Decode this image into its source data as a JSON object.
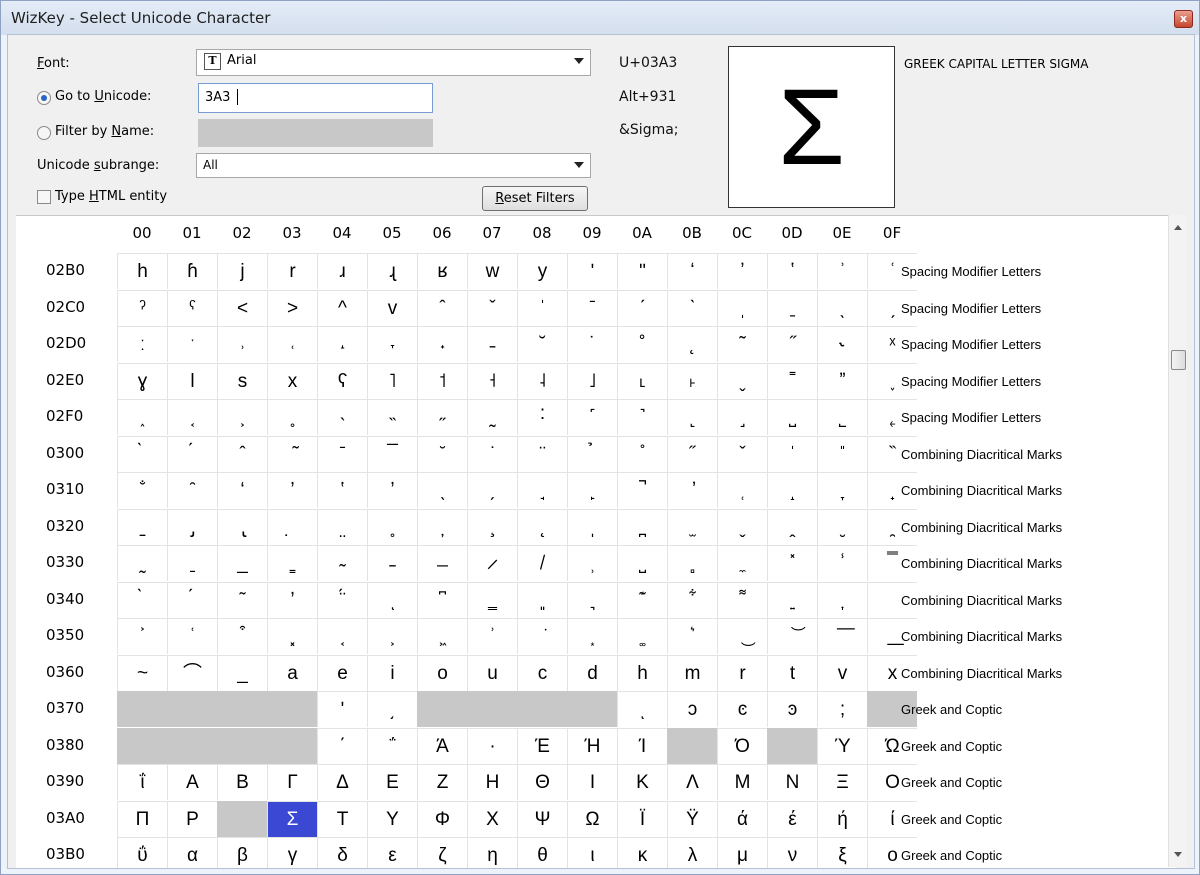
{
  "window": {
    "title": "WizKey - Select Unicode Character",
    "close_glyph": "x"
  },
  "controls": {
    "font_label_u": "F",
    "font_label_rest": "ont:",
    "font_value": "Arial",
    "font_icon_glyph": "T",
    "goto_label_pre": "Go to ",
    "goto_label_u": "U",
    "goto_label_rest": "nicode:",
    "goto_value": "3A3",
    "filter_label_pre": "Filter by ",
    "filter_label_u": "N",
    "filter_label_rest": "ame:",
    "subrange_label_pre": "Unicode ",
    "subrange_label_u": "s",
    "subrange_label_rest": "ubrange:",
    "subrange_value": "All",
    "html_label_pre": "Type ",
    "html_label_u": "H",
    "html_label_rest": "TML entity",
    "reset_u": "R",
    "reset_rest": "eset Filters"
  },
  "info": {
    "codepoint": "U+03A3",
    "alt_code": "Alt+931",
    "html_entity": "&Sigma;",
    "preview_glyph": "Σ",
    "char_name": "GREEK CAPITAL LETTER SIGMA"
  },
  "grid": {
    "columns": [
      "00",
      "01",
      "02",
      "03",
      "04",
      "05",
      "06",
      "07",
      "08",
      "09",
      "0A",
      "0B",
      "0C",
      "0D",
      "0E",
      "0F"
    ],
    "rows": [
      {
        "code": "02B0",
        "range": "Spacing Modifier Letters",
        "cells": [
          "h",
          "ɦ",
          "j",
          "r",
          "ɹ",
          "ɻ",
          "ʁ",
          "w",
          "y",
          "ʹ",
          "ʺ",
          "ʻ",
          "ʼ",
          "ʽ",
          "ʾ",
          "ʿ"
        ]
      },
      {
        "code": "02C0",
        "range": "Spacing Modifier Letters",
        "cells": [
          "ˀ",
          "ˁ",
          "<",
          ">",
          "^",
          "v",
          "ˆ",
          "ˇ",
          "ˈ",
          "ˉ",
          "ˊ",
          "ˋ",
          "ˌ",
          "ˍ",
          "ˎ",
          "ˏ"
        ]
      },
      {
        "code": "02D0",
        "range": "Spacing Modifier Letters",
        "cells": [
          "ː",
          "ˑ",
          "˒",
          "˓",
          "˔",
          "˕",
          "˖",
          "˗",
          "˘",
          "˙",
          "˚",
          "˛",
          "˜",
          "˝",
          "˞",
          "ˣ"
        ]
      },
      {
        "code": "02E0",
        "range": "Spacing Modifier Letters",
        "cells": [
          "ɣ",
          "l",
          "s",
          "x",
          "ʕ",
          "˥",
          "˦",
          "˧",
          "˨",
          "˩",
          "˪",
          "˫",
          "ˬ",
          "˭",
          "ˮ",
          "˯"
        ]
      },
      {
        "code": "02F0",
        "range": "Spacing Modifier Letters",
        "cells": [
          "˰",
          "˱",
          "˲",
          "˳",
          "˴",
          "˵",
          "˶",
          "˷",
          "˸",
          "˹",
          "˺",
          "˻",
          "˼",
          "˽",
          "˾",
          "˿"
        ]
      },
      {
        "code": "0300",
        "range": "Combining Diacritical Marks",
        "cells": [
          "̀",
          "́",
          "̂",
          "̃",
          "̄",
          "̅",
          "̆",
          "̇",
          "̈",
          "̉",
          "̊",
          "̋",
          "̌",
          "̍",
          "̎",
          "̏"
        ]
      },
      {
        "code": "0310",
        "range": "Combining Diacritical Marks",
        "cells": [
          "̐",
          "̑",
          "̒",
          "̓",
          "̔",
          "̕",
          "̖",
          "̗",
          "̘",
          "̙",
          "̚",
          "̛",
          "̜",
          "̝",
          "̞",
          "̟"
        ]
      },
      {
        "code": "0320",
        "range": "Combining Diacritical Marks",
        "cells": [
          "̠",
          "̡",
          "̢",
          "̣",
          "̤",
          "̥",
          "̦",
          "̧",
          "̨",
          "̩",
          "̪",
          "̫",
          "̬",
          "̭",
          "̮",
          "̯"
        ]
      },
      {
        "code": "0330",
        "range": "Combining Diacritical Marks",
        "cells": [
          "̰",
          "̱",
          "̲",
          "̳",
          "̴",
          "̵",
          "̶",
          "̷",
          "̸",
          "̹",
          "̺",
          "̻",
          "̼",
          "̽",
          "̾",
          "̿"
        ]
      },
      {
        "code": "0340",
        "range": "Combining Diacritical Marks",
        "cells": [
          "̀",
          "́",
          "͂",
          "̓",
          "̈́",
          "ͅ",
          "͆",
          "͇",
          "͈",
          "͉",
          "͊",
          "͋",
          "͌",
          "͍",
          "͎",
          "͏"
        ]
      },
      {
        "code": "0350",
        "range": "Combining Diacritical Marks",
        "cells": [
          "͐",
          "͑",
          "͒",
          "͓",
          "͔",
          "͕",
          "͖",
          "͗",
          "͘",
          "͙",
          "͚",
          "͛",
          "͜",
          "͝",
          "͞",
          "͟"
        ]
      },
      {
        "code": "0360",
        "range": "Combining Diacritical Marks",
        "cells": [
          "~",
          "⌒",
          "_",
          "a",
          "e",
          "i",
          "o",
          "u",
          "c",
          "d",
          "h",
          "m",
          "r",
          "t",
          "v",
          "x"
        ]
      },
      {
        "code": "0370",
        "range": "Greek and Coptic",
        "cells": [
          "",
          "",
          "",
          "",
          "ʹ",
          "͵",
          "",
          "",
          "",
          "",
          "ͺ",
          "ͻ",
          "ͼ",
          "ͽ",
          ";",
          ""
        ]
      },
      {
        "code": "0380",
        "range": "Greek and Coptic",
        "cells": [
          "",
          "",
          "",
          "",
          "΄",
          "΅",
          "Ά",
          "·",
          "Έ",
          "Ή",
          "Ί",
          "",
          "Ό",
          "",
          "Ύ",
          "Ώ"
        ]
      },
      {
        "code": "0390",
        "range": "Greek and Coptic",
        "cells": [
          "ΐ",
          "Α",
          "Β",
          "Γ",
          "Δ",
          "Ε",
          "Ζ",
          "Η",
          "Θ",
          "Ι",
          "Κ",
          "Λ",
          "Μ",
          "Ν",
          "Ξ",
          "Ο"
        ]
      },
      {
        "code": "03A0",
        "range": "Greek and Coptic",
        "cells": [
          "Π",
          "Ρ",
          "",
          "Σ",
          "Τ",
          "Υ",
          "Φ",
          "Χ",
          "Ψ",
          "Ω",
          "Ϊ",
          "Ϋ",
          "ά",
          "έ",
          "ή",
          "ί"
        ]
      },
      {
        "code": "03B0",
        "range": "Greek and Coptic",
        "cells": [
          "ΰ",
          "α",
          "β",
          "γ",
          "δ",
          "ε",
          "ζ",
          "η",
          "θ",
          "ι",
          "κ",
          "λ",
          "μ",
          "ν",
          "ξ",
          "ο"
        ]
      }
    ],
    "gray_cells": {
      "0370": [
        0,
        1,
        2,
        3,
        6,
        7,
        8,
        9,
        15
      ],
      "0380": [
        0,
        1,
        2,
        3,
        11,
        13
      ],
      "03A0": [
        2
      ]
    },
    "selected": {
      "row": "03A0",
      "col": 3
    }
  }
}
